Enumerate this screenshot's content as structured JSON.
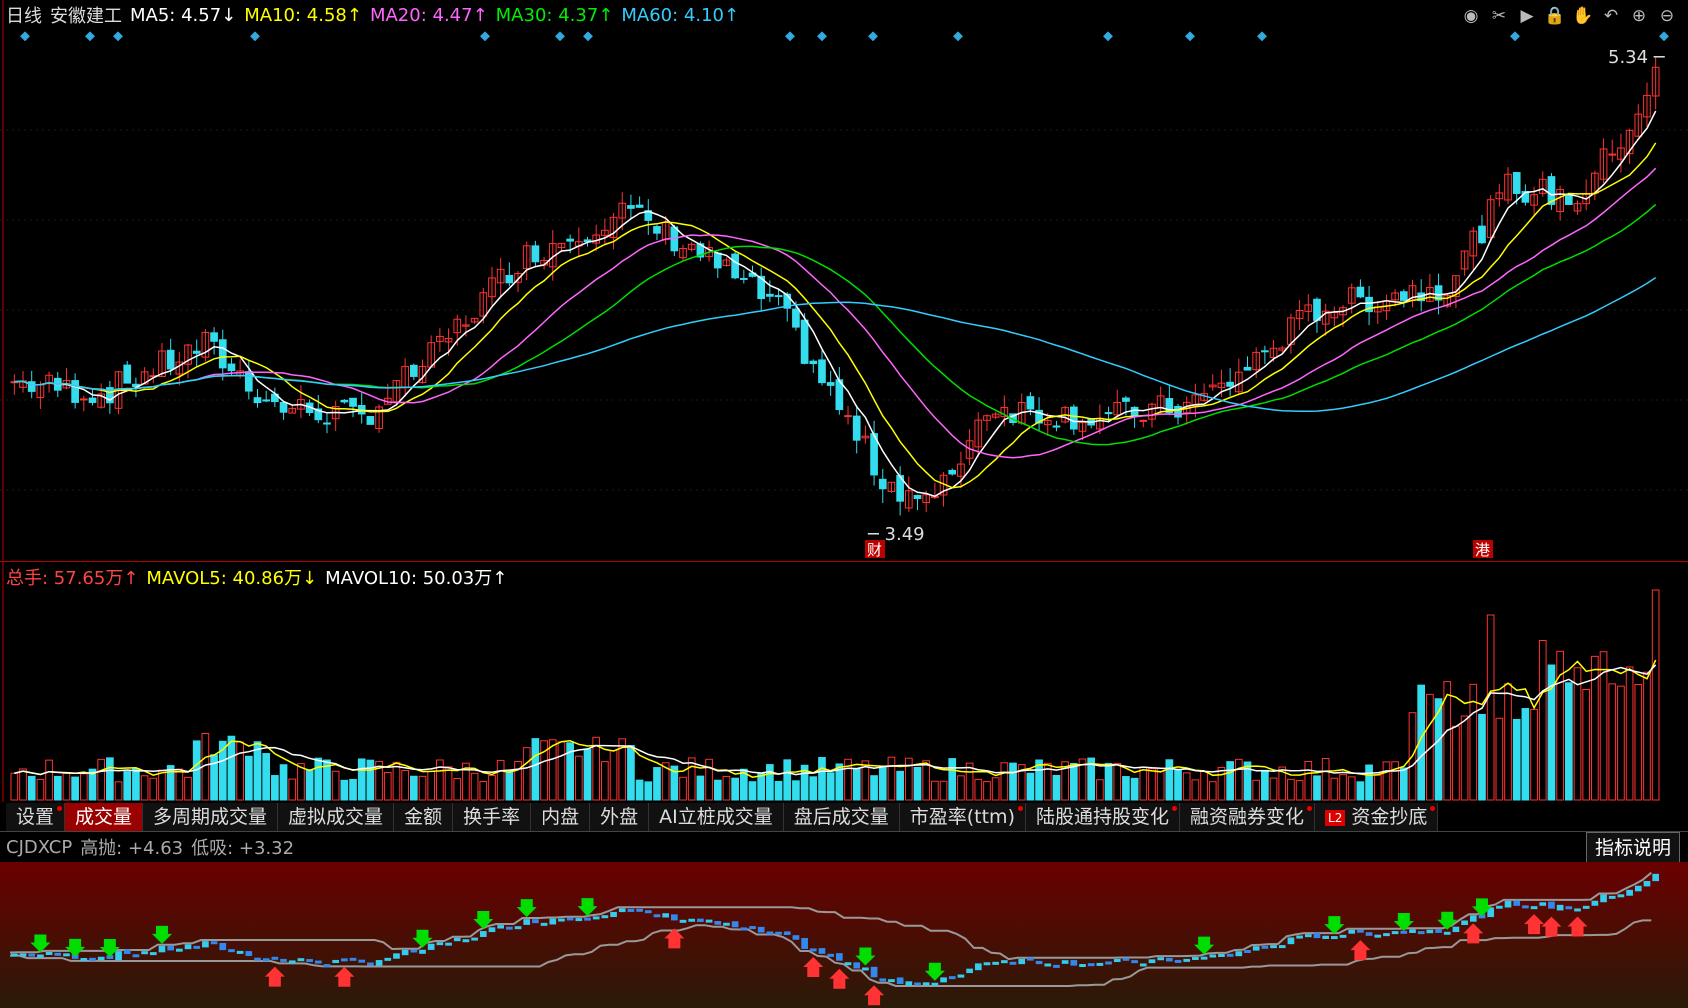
{
  "header": {
    "period": "日线",
    "stock_name": "安徽建工",
    "ma5": {
      "label": "MA5: 4.57↓",
      "color": "#ffffff"
    },
    "ma10": {
      "label": "MA10: 4.58↑",
      "color": "#ffff00"
    },
    "ma20": {
      "label": "MA20: 4.47↑",
      "color": "#ff66ff"
    },
    "ma30": {
      "label": "MA30: 4.37↑",
      "color": "#00ee00"
    },
    "ma60": {
      "label": "MA60: 4.10↑",
      "color": "#33ccff"
    }
  },
  "toolbar_icons": [
    "eye-icon",
    "scissors-icon",
    "play-icon",
    "lock-icon",
    "hand-icon",
    "undo-icon",
    "zoom-in-icon",
    "zoom-out-icon"
  ],
  "price_chart": {
    "high_label": "5.34",
    "low_label": "3.49",
    "marker_fin": "财",
    "marker_hk": "港"
  },
  "volume_header": {
    "total": "总手: 57.65万↑",
    "mavol5": "MAVOL5: 40.86万↓",
    "mavol10": "MAVOL10: 50.03万↑"
  },
  "tabs": [
    {
      "label": "设置",
      "active": false,
      "dot": true
    },
    {
      "label": "成交量",
      "active": true,
      "dot": false
    },
    {
      "label": "多周期成交量",
      "active": false,
      "dot": false
    },
    {
      "label": "虚拟成交量",
      "active": false,
      "dot": false
    },
    {
      "label": "金额",
      "active": false,
      "dot": false
    },
    {
      "label": "换手率",
      "active": false,
      "dot": false
    },
    {
      "label": "内盘",
      "active": false,
      "dot": false
    },
    {
      "label": "外盘",
      "active": false,
      "dot": false
    },
    {
      "label": "AI立桩成交量",
      "active": false,
      "dot": false
    },
    {
      "label": "盘后成交量",
      "active": false,
      "dot": false
    },
    {
      "label": "市盈率(ttm)",
      "active": false,
      "dot": true
    },
    {
      "label": "陆股通持股变化",
      "active": false,
      "dot": true
    },
    {
      "label": "融资融券变化",
      "active": false,
      "dot": true
    },
    {
      "label": "资金抄底",
      "active": false,
      "dot": true,
      "badge": "L2"
    }
  ],
  "indicator": {
    "name": "CJDXCP",
    "high": "高抛: +4.63",
    "low": "低吸: +3.32",
    "explain_button": "指标说明"
  },
  "colors": {
    "up": "#ff3333",
    "down": "#33ddee",
    "border": "#bb0000"
  }
}
